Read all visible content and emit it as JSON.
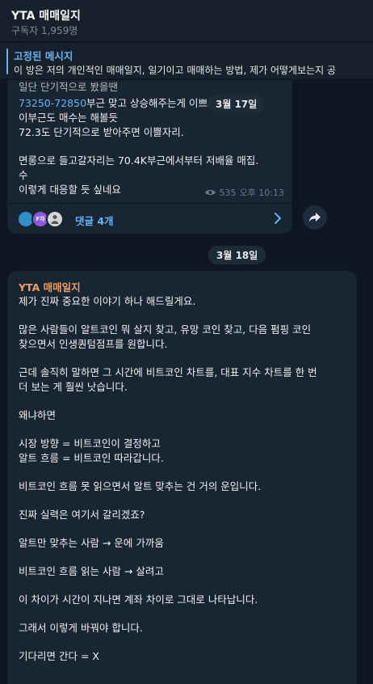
{
  "header": {
    "title": "YTA 매매일지",
    "subscribers": "구독자 1,959명"
  },
  "pinned": {
    "title": "고정된 메시지",
    "text": "이 방은 저의 개인적인 매매일지, 일기이고 매매하는 방법, 제가 어떻게보는지 공"
  },
  "dates": {
    "first": "3월 17일",
    "second": "3월 18일"
  },
  "post1": {
    "lines": {
      "l0": "일단 단기적으로 봤을땐",
      "l1_link": "73250-72850",
      "l1_rest": "부근 맞고 상승해주는게 이쁘",
      "l2": "이부근도 매수는 해볼듯",
      "l3": "72.3도 단기적으로 받아주면 이쁠자리.",
      "l4": "면롱으로 들고갈자리는 70.4K부근에서부터 저배율 매집.",
      "l5": "수",
      "l6": "이렇게 대응할 듯 싶네요"
    },
    "views": "535",
    "time": "오후 10:13",
    "comments_label": "댓글 4개",
    "avatar2_text": "F자"
  },
  "post2": {
    "sender": "YTA 매매일지",
    "lines": [
      "제가 진짜 중요한 이야기 하나 해드릴게요.",
      "많은 사람들이 알트코인 뭐 살지 찾고, 유망 코인 찾고, 다음 펌핑 코인",
      "찾으면서 인생퀀텀점프를 원합니다.",
      "근데 솔직히 말하면 그 시간에 비트코인 차트를, 대표 지수 차트를 한 번",
      "더 보는 게 훨씬 낫습니다.",
      "왜냐하면",
      "시장 방향 = 비트코인이 결정하고",
      "알트 흐름 = 비트코인 따라갑니다.",
      "비트코인 흐름 못 읽으면서 알트 맞추는 건 거의 운입니다.",
      "진짜 실력은 여기서 갈리겠죠?",
      "알트만 맞추는 사람 → 운에 가까움",
      "비트코인 흐름 읽는 사람 → 살려고",
      "이 차이가 시간이 지나면 계좌 차이로 그대로 나타납니다.",
      "그래서 이렇게 바꿔야 합니다.",
      "기다리면 간다 = X"
    ]
  },
  "colors": {
    "background": "#0e1621",
    "bubble": "#182533",
    "link": "#6ab2f2",
    "sender": "#f09d63"
  },
  "icons": {
    "views": "eye-icon",
    "comments_arrow": "chevron-right-icon",
    "share": "share-arrow-icon"
  }
}
